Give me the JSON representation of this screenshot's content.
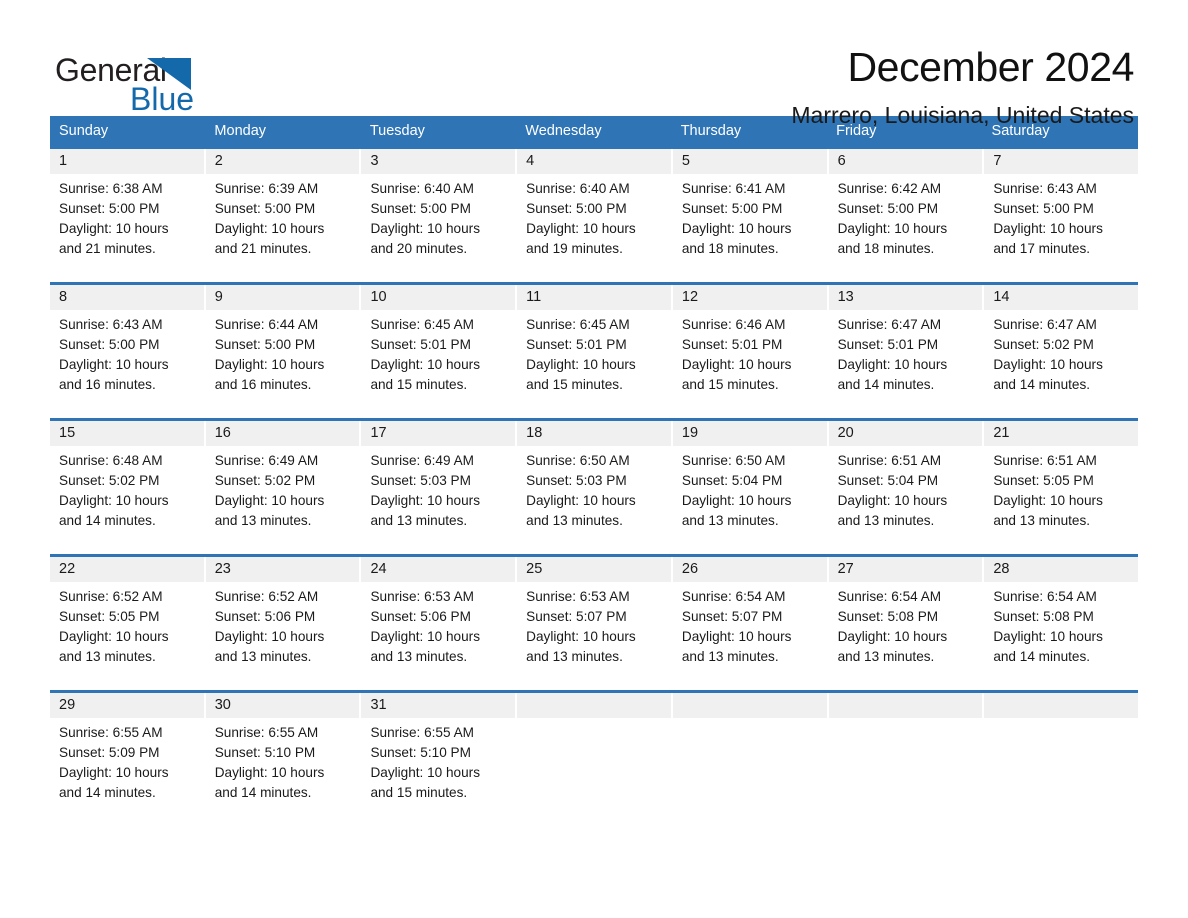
{
  "brand": {
    "name_part1": "General",
    "name_part2": "Blue",
    "accent_color": "#1469ab"
  },
  "header": {
    "title": "December 2024",
    "location": "Marrero, Louisiana, United States"
  },
  "calendar": {
    "header_bg_color": "#2f74b5",
    "daynum_bg_color": "#f0f0f0",
    "weekdays": [
      "Sunday",
      "Monday",
      "Tuesday",
      "Wednesday",
      "Thursday",
      "Friday",
      "Saturday"
    ],
    "weeks": [
      [
        {
          "day": "1",
          "sunrise": "Sunrise: 6:38 AM",
          "sunset": "Sunset: 5:00 PM",
          "daylight_line1": "Daylight: 10 hours",
          "daylight_line2": "and 21 minutes."
        },
        {
          "day": "2",
          "sunrise": "Sunrise: 6:39 AM",
          "sunset": "Sunset: 5:00 PM",
          "daylight_line1": "Daylight: 10 hours",
          "daylight_line2": "and 21 minutes."
        },
        {
          "day": "3",
          "sunrise": "Sunrise: 6:40 AM",
          "sunset": "Sunset: 5:00 PM",
          "daylight_line1": "Daylight: 10 hours",
          "daylight_line2": "and 20 minutes."
        },
        {
          "day": "4",
          "sunrise": "Sunrise: 6:40 AM",
          "sunset": "Sunset: 5:00 PM",
          "daylight_line1": "Daylight: 10 hours",
          "daylight_line2": "and 19 minutes."
        },
        {
          "day": "5",
          "sunrise": "Sunrise: 6:41 AM",
          "sunset": "Sunset: 5:00 PM",
          "daylight_line1": "Daylight: 10 hours",
          "daylight_line2": "and 18 minutes."
        },
        {
          "day": "6",
          "sunrise": "Sunrise: 6:42 AM",
          "sunset": "Sunset: 5:00 PM",
          "daylight_line1": "Daylight: 10 hours",
          "daylight_line2": "and 18 minutes."
        },
        {
          "day": "7",
          "sunrise": "Sunrise: 6:43 AM",
          "sunset": "Sunset: 5:00 PM",
          "daylight_line1": "Daylight: 10 hours",
          "daylight_line2": "and 17 minutes."
        }
      ],
      [
        {
          "day": "8",
          "sunrise": "Sunrise: 6:43 AM",
          "sunset": "Sunset: 5:00 PM",
          "daylight_line1": "Daylight: 10 hours",
          "daylight_line2": "and 16 minutes."
        },
        {
          "day": "9",
          "sunrise": "Sunrise: 6:44 AM",
          "sunset": "Sunset: 5:00 PM",
          "daylight_line1": "Daylight: 10 hours",
          "daylight_line2": "and 16 minutes."
        },
        {
          "day": "10",
          "sunrise": "Sunrise: 6:45 AM",
          "sunset": "Sunset: 5:01 PM",
          "daylight_line1": "Daylight: 10 hours",
          "daylight_line2": "and 15 minutes."
        },
        {
          "day": "11",
          "sunrise": "Sunrise: 6:45 AM",
          "sunset": "Sunset: 5:01 PM",
          "daylight_line1": "Daylight: 10 hours",
          "daylight_line2": "and 15 minutes."
        },
        {
          "day": "12",
          "sunrise": "Sunrise: 6:46 AM",
          "sunset": "Sunset: 5:01 PM",
          "daylight_line1": "Daylight: 10 hours",
          "daylight_line2": "and 15 minutes."
        },
        {
          "day": "13",
          "sunrise": "Sunrise: 6:47 AM",
          "sunset": "Sunset: 5:01 PM",
          "daylight_line1": "Daylight: 10 hours",
          "daylight_line2": "and 14 minutes."
        },
        {
          "day": "14",
          "sunrise": "Sunrise: 6:47 AM",
          "sunset": "Sunset: 5:02 PM",
          "daylight_line1": "Daylight: 10 hours",
          "daylight_line2": "and 14 minutes."
        }
      ],
      [
        {
          "day": "15",
          "sunrise": "Sunrise: 6:48 AM",
          "sunset": "Sunset: 5:02 PM",
          "daylight_line1": "Daylight: 10 hours",
          "daylight_line2": "and 14 minutes."
        },
        {
          "day": "16",
          "sunrise": "Sunrise: 6:49 AM",
          "sunset": "Sunset: 5:02 PM",
          "daylight_line1": "Daylight: 10 hours",
          "daylight_line2": "and 13 minutes."
        },
        {
          "day": "17",
          "sunrise": "Sunrise: 6:49 AM",
          "sunset": "Sunset: 5:03 PM",
          "daylight_line1": "Daylight: 10 hours",
          "daylight_line2": "and 13 minutes."
        },
        {
          "day": "18",
          "sunrise": "Sunrise: 6:50 AM",
          "sunset": "Sunset: 5:03 PM",
          "daylight_line1": "Daylight: 10 hours",
          "daylight_line2": "and 13 minutes."
        },
        {
          "day": "19",
          "sunrise": "Sunrise: 6:50 AM",
          "sunset": "Sunset: 5:04 PM",
          "daylight_line1": "Daylight: 10 hours",
          "daylight_line2": "and 13 minutes."
        },
        {
          "day": "20",
          "sunrise": "Sunrise: 6:51 AM",
          "sunset": "Sunset: 5:04 PM",
          "daylight_line1": "Daylight: 10 hours",
          "daylight_line2": "and 13 minutes."
        },
        {
          "day": "21",
          "sunrise": "Sunrise: 6:51 AM",
          "sunset": "Sunset: 5:05 PM",
          "daylight_line1": "Daylight: 10 hours",
          "daylight_line2": "and 13 minutes."
        }
      ],
      [
        {
          "day": "22",
          "sunrise": "Sunrise: 6:52 AM",
          "sunset": "Sunset: 5:05 PM",
          "daylight_line1": "Daylight: 10 hours",
          "daylight_line2": "and 13 minutes."
        },
        {
          "day": "23",
          "sunrise": "Sunrise: 6:52 AM",
          "sunset": "Sunset: 5:06 PM",
          "daylight_line1": "Daylight: 10 hours",
          "daylight_line2": "and 13 minutes."
        },
        {
          "day": "24",
          "sunrise": "Sunrise: 6:53 AM",
          "sunset": "Sunset: 5:06 PM",
          "daylight_line1": "Daylight: 10 hours",
          "daylight_line2": "and 13 minutes."
        },
        {
          "day": "25",
          "sunrise": "Sunrise: 6:53 AM",
          "sunset": "Sunset: 5:07 PM",
          "daylight_line1": "Daylight: 10 hours",
          "daylight_line2": "and 13 minutes."
        },
        {
          "day": "26",
          "sunrise": "Sunrise: 6:54 AM",
          "sunset": "Sunset: 5:07 PM",
          "daylight_line1": "Daylight: 10 hours",
          "daylight_line2": "and 13 minutes."
        },
        {
          "day": "27",
          "sunrise": "Sunrise: 6:54 AM",
          "sunset": "Sunset: 5:08 PM",
          "daylight_line1": "Daylight: 10 hours",
          "daylight_line2": "and 13 minutes."
        },
        {
          "day": "28",
          "sunrise": "Sunrise: 6:54 AM",
          "sunset": "Sunset: 5:08 PM",
          "daylight_line1": "Daylight: 10 hours",
          "daylight_line2": "and 14 minutes."
        }
      ],
      [
        {
          "day": "29",
          "sunrise": "Sunrise: 6:55 AM",
          "sunset": "Sunset: 5:09 PM",
          "daylight_line1": "Daylight: 10 hours",
          "daylight_line2": "and 14 minutes."
        },
        {
          "day": "30",
          "sunrise": "Sunrise: 6:55 AM",
          "sunset": "Sunset: 5:10 PM",
          "daylight_line1": "Daylight: 10 hours",
          "daylight_line2": "and 14 minutes."
        },
        {
          "day": "31",
          "sunrise": "Sunrise: 6:55 AM",
          "sunset": "Sunset: 5:10 PM",
          "daylight_line1": "Daylight: 10 hours",
          "daylight_line2": "and 15 minutes."
        },
        {
          "day": "",
          "sunrise": "",
          "sunset": "",
          "daylight_line1": "",
          "daylight_line2": ""
        },
        {
          "day": "",
          "sunrise": "",
          "sunset": "",
          "daylight_line1": "",
          "daylight_line2": ""
        },
        {
          "day": "",
          "sunrise": "",
          "sunset": "",
          "daylight_line1": "",
          "daylight_line2": ""
        },
        {
          "day": "",
          "sunrise": "",
          "sunset": "",
          "daylight_line1": "",
          "daylight_line2": ""
        }
      ]
    ]
  }
}
